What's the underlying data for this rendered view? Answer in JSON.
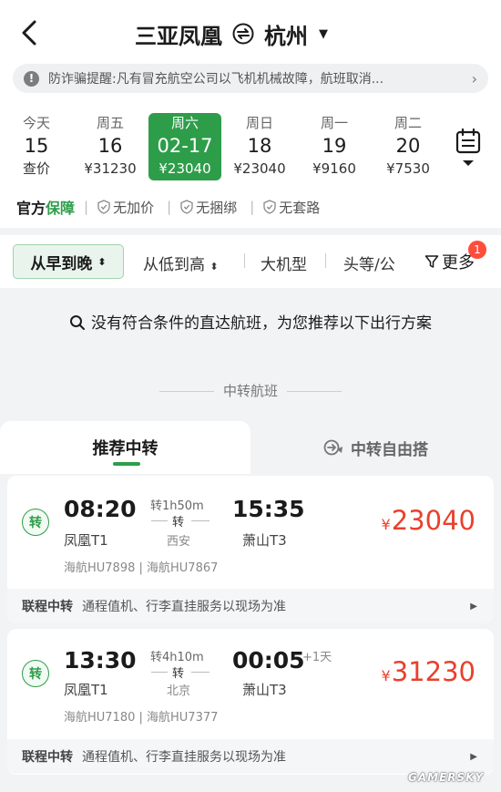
{
  "header": {
    "origin": "三亚凤凰",
    "destination": "杭州",
    "notice": "防诈骗提醒:凡有冒充航空公司以飞机机械故障，航班取消..."
  },
  "dates": [
    {
      "weekday": "今天",
      "day": "15",
      "price": "查价",
      "selected": false
    },
    {
      "weekday": "周五",
      "day": "16",
      "price": "¥31230",
      "selected": false
    },
    {
      "weekday": "周六",
      "day": "02-17",
      "price": "¥23040",
      "selected": true
    },
    {
      "weekday": "周日",
      "day": "18",
      "price": "¥23040",
      "selected": false
    },
    {
      "weekday": "周一",
      "day": "19",
      "price": "¥9160",
      "selected": false
    },
    {
      "weekday": "周二",
      "day": "20",
      "price": "¥7530",
      "selected": false
    }
  ],
  "guarantee": {
    "label_a": "官方",
    "label_b": "保障",
    "items": [
      "无加价",
      "无捆绑",
      "无套路"
    ]
  },
  "filters": {
    "sort_time": "从早到晚",
    "sort_price": "从低到高",
    "large_plane": "大机型",
    "cabin": "头等/公",
    "more": "更多",
    "more_badge": "1"
  },
  "empty_message": "没有符合条件的直达航班，为您推荐以下出行方案",
  "section_title": "中转航班",
  "tabs": {
    "recommended": "推荐中转",
    "free": "中转自由搭"
  },
  "cards": [
    {
      "badge": "转",
      "dep_time": "08:20",
      "dep_airport": "凤凰T1",
      "layover": "转1h50m",
      "transfer_mark": "转",
      "transfer_city": "西安",
      "arr_time": "15:35",
      "arr_airport": "萧山T3",
      "next_day": "",
      "price_symbol": "¥",
      "price": "23040",
      "flights": "海航HU7898 | 海航HU7867",
      "sub_label": "联程中转",
      "sub_text": "通程值机、行李直挂服务以现场为准"
    },
    {
      "badge": "转",
      "dep_time": "13:30",
      "dep_airport": "凤凰T1",
      "layover": "转4h10m",
      "transfer_mark": "转",
      "transfer_city": "北京",
      "arr_time": "00:05",
      "arr_airport": "萧山T3",
      "next_day": "+1天",
      "price_symbol": "¥",
      "price": "31230",
      "flights": "海航HU7180 | 海航HU7377",
      "sub_label": "联程中转",
      "sub_text": "通程值机、行李直挂服务以现场为准"
    }
  ],
  "watermark": "GAMERSKY",
  "colors": {
    "accent_green": "#2e9d4a",
    "price_red": "#e9402d",
    "badge_red": "#ff4d3b"
  }
}
